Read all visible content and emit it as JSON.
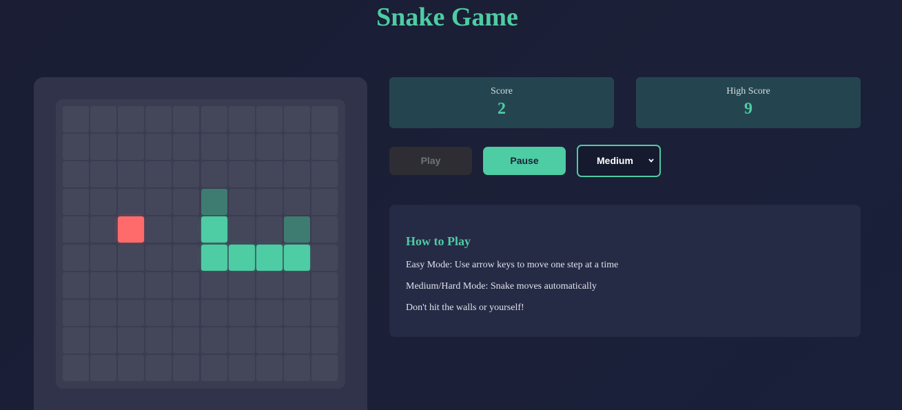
{
  "title": "Snake Game",
  "score": {
    "label": "Score",
    "value": "2"
  },
  "high_score": {
    "label": "High Score",
    "value": "9"
  },
  "controls": {
    "play_label": "Play",
    "pause_label": "Pause",
    "difficulty_selected": "Medium"
  },
  "instructions": {
    "heading": "How to Play",
    "lines": [
      "Easy Mode: Use arrow keys to move one step at a time",
      "Medium/Hard Mode: Snake moves automatically",
      "Don't hit the walls or yourself!"
    ]
  },
  "board": {
    "rows": 10,
    "cols": 10,
    "snake_bright": [
      [
        4,
        5
      ],
      [
        5,
        5
      ],
      [
        5,
        6
      ],
      [
        5,
        7
      ],
      [
        5,
        8
      ]
    ],
    "snake_dim": [
      [
        3,
        5
      ],
      [
        4,
        8
      ]
    ],
    "food": [
      4,
      2
    ]
  },
  "colors": {
    "accent": "#4ecca3",
    "food": "#ff6b6b",
    "empty_cell": "#44465a",
    "snake_dim": "#3e7b70"
  }
}
